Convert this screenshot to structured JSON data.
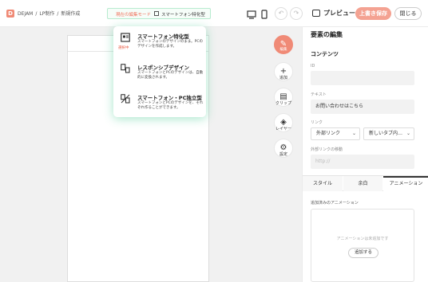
{
  "header": {
    "logo_letter": "D",
    "breadcrumbs": [
      "DEJAM",
      "/",
      "LP制作",
      "/",
      "新規作成"
    ],
    "mode_label": "現在の編集モード",
    "mode_value": "スマートフォン特化型",
    "preview_label": "プレビュー",
    "save_label": "上書き保存",
    "close_label": "閉じる",
    "undo_icon": "undo-icon",
    "redo_icon": "redo-icon"
  },
  "mode_menu": {
    "items": [
      {
        "title": "スマートフォン特化型",
        "desc": "スマートフォンのデザインのまま。PCのデザインを作成します。",
        "selected_label": "選択中",
        "icon": "smartphone-layout-icon"
      },
      {
        "title": "レスポンシブデザイン",
        "desc": "スマートフォンとPCのデザインは、自動的に変換されます。",
        "selected_label": "",
        "icon": "responsive-icon"
      },
      {
        "title": "スマートフォン・PC独立型",
        "desc": "スマートフォンとPCのデザインを、それぞれ作ることができます。",
        "selected_label": "",
        "icon": "independent-icon"
      }
    ]
  },
  "tools": [
    {
      "label": "編集",
      "icon": "pencil-icon",
      "glyph": "✎"
    },
    {
      "label": "追加",
      "icon": "plus-icon",
      "glyph": "+"
    },
    {
      "label": "クリップ",
      "icon": "clipboard-icon",
      "glyph": "▤"
    },
    {
      "label": "レイヤー",
      "icon": "layers-icon",
      "glyph": "◈"
    },
    {
      "label": "設定",
      "icon": "gear-icon",
      "glyph": "⚙"
    }
  ],
  "panel": {
    "title": "要素の編集",
    "section": "コンテンツ",
    "id_label": "ID",
    "id_value": "",
    "text_label": "テキスト",
    "text_value": "お問い合わせはこちら",
    "link_label": "リンク",
    "link_type": "外部リンク",
    "link_target": "新しいタブ内…",
    "external_label": "外部リンクの移動",
    "external_placeholder": "http://",
    "tabs": [
      "スタイル",
      "余白",
      "アニメーション"
    ],
    "active_tab": "アニメーション",
    "anim_label": "追加済みのアニメーション",
    "anim_empty": "アニメーションは未追加です",
    "anim_add": "追加する"
  },
  "colors": {
    "accent": "#f08a76",
    "save_button": "#f4a292",
    "menu_glow": "#3cc88c"
  }
}
